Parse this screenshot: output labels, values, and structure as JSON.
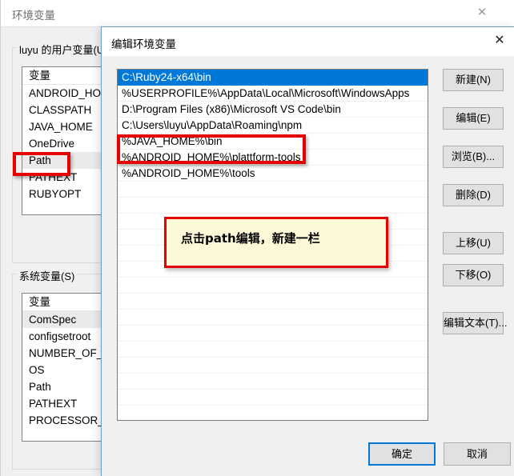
{
  "background_window": {
    "title": "环境变量",
    "close_icon": "close-icon",
    "user_variables": {
      "legend": "luyu 的用户变量(U)",
      "column_header": "变量",
      "items": [
        "ANDROID_HOME",
        "CLASSPATH",
        "JAVA_HOME",
        "OneDrive",
        "Path",
        "PATHEXT",
        "RUBYOPT"
      ],
      "selected": "Path"
    },
    "system_variables": {
      "legend": "系统变量(S)",
      "column_header": "变量",
      "items": [
        "ComSpec",
        "configsetroot",
        "NUMBER_OF_PR",
        "OS",
        "Path",
        "PATHEXT",
        "PROCESSOR_AR"
      ],
      "selected": "ComSpec"
    }
  },
  "edit_dialog": {
    "title": "编辑环境变量",
    "close_icon": "close-icon",
    "path_entries": [
      "C:\\Ruby24-x64\\bin",
      "%USERPROFILE%\\AppData\\Local\\Microsoft\\WindowsApps",
      "D:\\Program Files (x86)\\Microsoft VS Code\\bin",
      "C:\\Users\\luyu\\AppData\\Roaming\\npm",
      "%JAVA_HOME%\\bin",
      "%ANDROID_HOME%\\plattform-tools",
      "%ANDROID_HOME%\\tools"
    ],
    "selected_index": 0,
    "empty_row_count": 15,
    "side_buttons": [
      {
        "label": "新建(N)",
        "name": "new-button"
      },
      {
        "label": "编辑(E)",
        "name": "edit-button"
      },
      {
        "label": "浏览(B)...",
        "name": "browse-button"
      },
      {
        "label": "删除(D)",
        "name": "delete-button"
      },
      {
        "label": "上移(U)",
        "name": "move-up-button"
      },
      {
        "label": "下移(O)",
        "name": "move-down-button"
      },
      {
        "label": "编辑文本(T)...",
        "name": "edit-text-button"
      }
    ],
    "ok_label": "确定",
    "cancel_label": "取消"
  },
  "annotations": {
    "note_text": "点击path编辑，新建一栏",
    "highlight_path_variable": "Path",
    "highlight_path_entry": "%JAVA_HOME%\\bin"
  },
  "colors": {
    "accent_blue": "#0078d7",
    "annotation_red": "#e60000",
    "note_background": "#fcf8d8",
    "dialog_background": "#f0f0f0"
  }
}
